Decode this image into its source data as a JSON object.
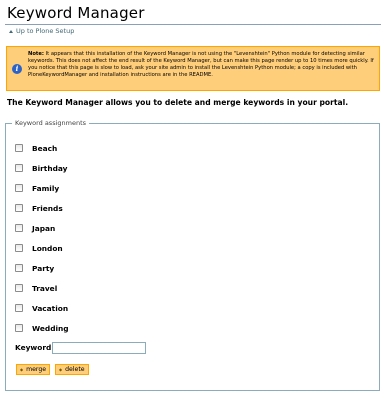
{
  "page": {
    "title": "Keyword Manager",
    "up_link": "Up to Plone Setup"
  },
  "note": {
    "icon": "info-icon",
    "prefix": "Note:",
    "text": "It appears that this installation of the Keyword Manager is not using the \"Levenshtein\" Python module for detecting similar keywords. This does not affect the end result of the Keyword Manager, but can make this page render up to 10 times more quickly. If you notice that this page is slow to load, ask your site admin to install the Levenshtein Python module; a copy is included with PloneKeywordManager and installation instructions are in the README."
  },
  "description": "The Keyword Manager allows you to delete and merge keywords in your portal.",
  "fieldset": {
    "legend": "Keyword assignments",
    "keywords": [
      "Beach",
      "Birthday",
      "Family",
      "Friends",
      "Japan",
      "London",
      "Party",
      "Travel",
      "Vacation",
      "Wedding"
    ]
  },
  "form": {
    "keyword_label": "Keyword",
    "keyword_value": "",
    "merge_label": "merge",
    "delete_label": "delete"
  },
  "colors": {
    "note_bg": "#ffce7b",
    "note_border": "#ffa500",
    "link": "#436976",
    "fieldset_border": "#8cacbb"
  }
}
